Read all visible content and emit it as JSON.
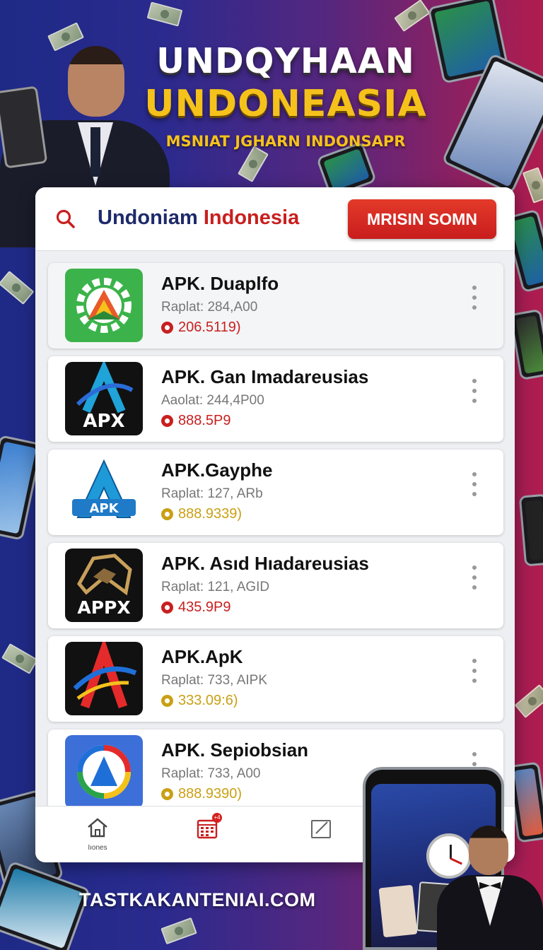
{
  "banner": {
    "title_line1": "UNDQYHAAN",
    "title_line2": "UNDONEASIA",
    "subtitle": "MSNIAT JGHARN INDONSAPR"
  },
  "search": {
    "title_part1": "Undoniam ",
    "title_part2": "Indonesia",
    "cta_label": "MRISIN SOMN"
  },
  "apps": [
    {
      "name": "APK. Duaplfo",
      "meta": "Raplat: 284,A00",
      "price": "206.5119)",
      "price_color": "#c91f1f"
    },
    {
      "name": "APK. Gan Imadareusias",
      "meta": "Aaolat: 244,4P00",
      "price": "888.5P9",
      "price_color": "#c91f1f",
      "icon_text": "APX"
    },
    {
      "name": "APK.Gayphe",
      "meta": "Raplat: 127, ARb",
      "price": "888.9339)",
      "price_color": "#c9a015",
      "icon_text": "APK"
    },
    {
      "name": "APK. Asıd Hıadareusias",
      "meta": "Raplat: 121, AGID",
      "price": "435.9P9",
      "price_color": "#c91f1f",
      "icon_text": "APPX"
    },
    {
      "name": "APK.ApK",
      "meta": "Raplat: 733, AIPK",
      "price": "333.09:6)",
      "price_color": "#c9a015"
    },
    {
      "name": "APK. Sepiobsian",
      "meta": "Raplat: 733, A00",
      "price": "888.9390)",
      "price_color": "#c9a015"
    }
  ],
  "nav": {
    "home_label": "Iıones",
    "calendar_badge": "+4"
  },
  "footer": {
    "url": "TASTKAKANTENIAI.COM"
  },
  "colors": {
    "accent_red": "#c91f1f",
    "gold": "#f5c21c",
    "navy": "#1e2a6a"
  }
}
